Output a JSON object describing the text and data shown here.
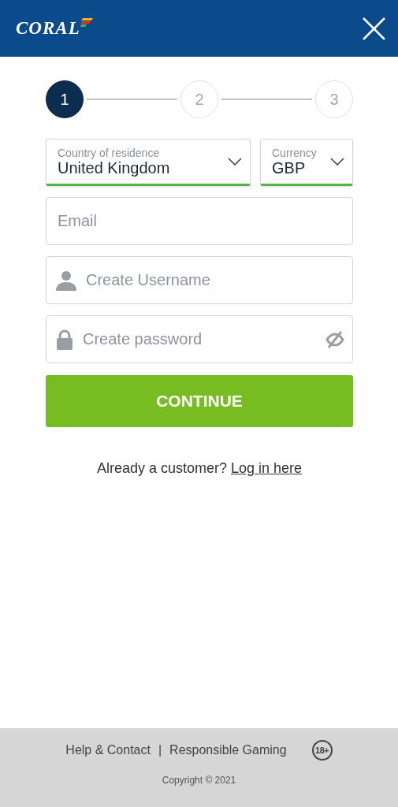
{
  "header": {
    "logo": "CORAL"
  },
  "steps": [
    {
      "label": "1",
      "selected": true
    },
    {
      "label": "2",
      "selected": false
    },
    {
      "label": "3",
      "selected": false
    }
  ],
  "selects": [
    {
      "label": "Country of residence",
      "value": "United Kingdom"
    },
    {
      "label": "Currency",
      "value": "GBP"
    }
  ],
  "fields": [
    {
      "kind": "email",
      "placeholder": "Email"
    },
    {
      "kind": "username",
      "placeholder": "Create Username"
    },
    {
      "kind": "password",
      "placeholder": "Create password"
    }
  ],
  "continue_button": "CONTINUE",
  "login_prompt": {
    "text": "Already a customer?",
    "link": "Log in here"
  },
  "footer": {
    "links": [
      "Help & Contact",
      "Responsible Gaming"
    ],
    "separator": "|",
    "age_badge": "18+",
    "copyright": "Copyright © 2021"
  }
}
